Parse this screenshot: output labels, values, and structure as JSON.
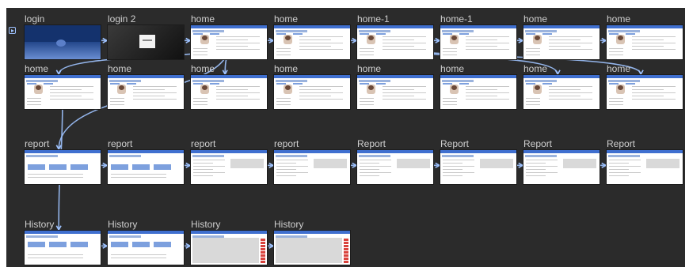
{
  "canvas": {
    "background": "#2b2b2b",
    "accent": "#9fc3ff",
    "header_color": "#3f6fcf"
  },
  "start_icon": "play-flag-icon",
  "screens": [
    {
      "id": "login",
      "title": "login",
      "kind": "login"
    },
    {
      "id": "login-2",
      "title": "login 2",
      "kind": "login2"
    },
    {
      "id": "home-a",
      "title": "home",
      "kind": "home"
    },
    {
      "id": "home-b",
      "title": "home",
      "kind": "home"
    },
    {
      "id": "home-1-a",
      "title": "home-1",
      "kind": "home"
    },
    {
      "id": "home-1-b",
      "title": "home-1",
      "kind": "home"
    },
    {
      "id": "home-c",
      "title": "home",
      "kind": "home"
    },
    {
      "id": "home-d",
      "title": "home",
      "kind": "home"
    },
    {
      "id": "home-e",
      "title": "home",
      "kind": "home"
    },
    {
      "id": "home-f",
      "title": "home",
      "kind": "home"
    },
    {
      "id": "home-g",
      "title": "home",
      "kind": "home"
    },
    {
      "id": "home-h",
      "title": "home",
      "kind": "home"
    },
    {
      "id": "home-i",
      "title": "home",
      "kind": "home"
    },
    {
      "id": "home-j",
      "title": "home",
      "kind": "home"
    },
    {
      "id": "home-k",
      "title": "home",
      "kind": "home"
    },
    {
      "id": "home-l",
      "title": "home",
      "kind": "home"
    },
    {
      "id": "report-a",
      "title": "report",
      "kind": "report-list"
    },
    {
      "id": "report-b",
      "title": "report",
      "kind": "report-list"
    },
    {
      "id": "report-c",
      "title": "report",
      "kind": "report"
    },
    {
      "id": "report-d",
      "title": "report",
      "kind": "report"
    },
    {
      "id": "report-e",
      "title": "Report",
      "kind": "report"
    },
    {
      "id": "report-f",
      "title": "Report",
      "kind": "report"
    },
    {
      "id": "report-g",
      "title": "Report",
      "kind": "report"
    },
    {
      "id": "report-h",
      "title": "Report",
      "kind": "report"
    },
    {
      "id": "history-a",
      "title": "History",
      "kind": "history-list"
    },
    {
      "id": "history-b",
      "title": "History",
      "kind": "history-list"
    },
    {
      "id": "history-c",
      "title": "History",
      "kind": "history-table"
    },
    {
      "id": "history-d",
      "title": "History",
      "kind": "history-table"
    }
  ],
  "links": [
    [
      "login",
      "login-2"
    ],
    [
      "login-2",
      "home-a"
    ],
    [
      "home-a",
      "home-b"
    ],
    [
      "home-b",
      "home-1-a"
    ],
    [
      "home-1-a",
      "home-1-b"
    ],
    [
      "home-1-b",
      "home-c"
    ],
    [
      "home-c",
      "home-d"
    ],
    [
      "home-a",
      "home-e"
    ],
    [
      "home-a",
      "home-g"
    ],
    [
      "home-1-a",
      "home-k"
    ],
    [
      "home-1-a",
      "home-l"
    ],
    [
      "home-a",
      "report-a"
    ],
    [
      "home-e",
      "history-a"
    ],
    [
      "report-a",
      "report-b"
    ],
    [
      "report-b",
      "report-c"
    ],
    [
      "report-c",
      "report-d"
    ],
    [
      "report-d",
      "report-e"
    ],
    [
      "report-e",
      "report-f"
    ],
    [
      "report-f",
      "report-g"
    ],
    [
      "report-g",
      "report-h"
    ],
    [
      "history-a",
      "history-b"
    ],
    [
      "history-b",
      "history-c"
    ],
    [
      "history-c",
      "history-d"
    ]
  ]
}
